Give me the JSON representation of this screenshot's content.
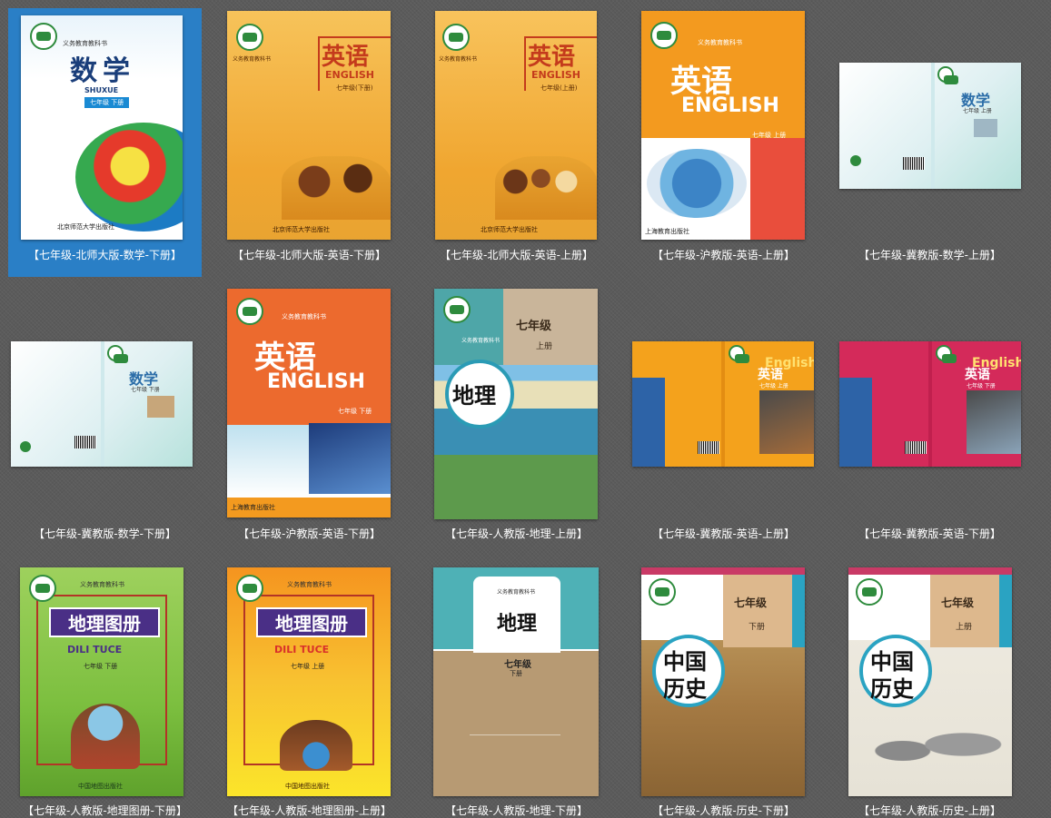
{
  "books": [
    {
      "caption": "【七年级-北师大版-数学-下册】",
      "title": "数学",
      "pinyin": "SHUXUE",
      "grade": "七年级 下册",
      "series": "义务教育教科书",
      "publisher": "北京师范大学出版社"
    },
    {
      "caption": "【七年级-北师大版-英语-下册】",
      "title": "英语",
      "english": "ENGLISH",
      "grade": "七年级(下册)",
      "series": "义务教育教科书",
      "publisher": "北京师范大学出版社"
    },
    {
      "caption": "【七年级-北师大版-英语-上册】",
      "title": "英语",
      "english": "ENGLISH",
      "grade": "七年级(上册)",
      "series": "义务教育教科书",
      "publisher": "北京师范大学出版社"
    },
    {
      "caption": "【七年级-沪教版-英语-上册】",
      "title": "英语",
      "english": "ENGLISH",
      "grade": "七年级 上册",
      "series": "义务教育教科书",
      "publisher": "上海教育出版社"
    },
    {
      "caption": "【七年级-冀教版-数学-上册】",
      "title": "数学",
      "grade": "七年级 上册"
    },
    {
      "caption": "【七年级-冀教版-数学-下册】",
      "title": "数学",
      "grade": "七年级 下册"
    },
    {
      "caption": "【七年级-沪教版-英语-下册】",
      "title": "英语",
      "english": "ENGLISH",
      "grade": "七年级 下册",
      "series": "义务教育教科书",
      "publisher": "上海教育出版社"
    },
    {
      "caption": "【七年级-人教版-地理-上册】",
      "title": "地理",
      "grade": "七年级",
      "volume": "上册",
      "series": "义务教育教科书"
    },
    {
      "caption": "【七年级-冀教版-英语-上册】",
      "title": "英语",
      "english": "English",
      "grade": "七年级 上册"
    },
    {
      "caption": "【七年级-冀教版-英语-下册】",
      "title": "英语",
      "english": "English",
      "grade": "七年级 下册"
    },
    {
      "caption": "【七年级-人教版-地理图册-下册】",
      "title": "地理图册",
      "pinyin": "DILI TUCE",
      "grade": "七年级 下册",
      "series": "义务教育教科书",
      "publisher": "中国地图出版社"
    },
    {
      "caption": "【七年级-人教版-地理图册-上册】",
      "title": "地理图册",
      "pinyin": "DILI TUCE",
      "grade": "七年级 上册",
      "series": "义务教育教科书",
      "publisher": "中国地图出版社"
    },
    {
      "caption": "【七年级-人教版-地理-下册】",
      "title": "地理",
      "grade": "七年级",
      "volume": "下册",
      "series": "义务教育教科书"
    },
    {
      "caption": "【七年级-人教版-历史-下册】",
      "title_line1": "中国",
      "title_line2": "历史",
      "grade": "七年级",
      "volume": "下册"
    },
    {
      "caption": "【七年级-人教版-历史-上册】",
      "title_line1": "中国",
      "title_line2": "历史",
      "grade": "七年级",
      "volume": "上册"
    }
  ],
  "selected_index": 0,
  "colors": {
    "page_bg": "#5b5b5b",
    "selection": "#2a7fc6",
    "caption_text": "#ffffff"
  }
}
